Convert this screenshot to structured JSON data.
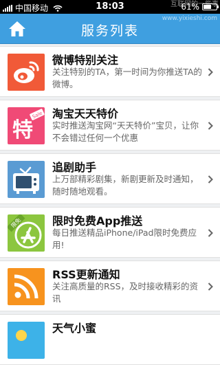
{
  "status_bar": {
    "carrier": "中国移动",
    "time": "18:03",
    "battery": "61%"
  },
  "watermark": {
    "text": "互联网的一些事",
    "url": "www.yixieshi.com"
  },
  "nav": {
    "title": "服务列表"
  },
  "colors": {
    "nav_blue": "#3f9fe0",
    "weibo": "#f15a38",
    "taobao": "#f04a76",
    "tv": "#5a9bd3",
    "app": "#8cc63f",
    "rss": "#f7931e",
    "weather": "#3db2e8"
  },
  "items": [
    {
      "title": "微博特别关注",
      "desc": "关注特别的TA，第一时间为你推送TA的微博。",
      "icon": "weibo-icon"
    },
    {
      "title": "淘宝天天特价",
      "desc": "实时推送淘宝网“天天特价”宝贝，让你不会错过任何一个优惠",
      "icon": "taobao-sale-icon",
      "icon_text": "特",
      "icon_tag": "Sale"
    },
    {
      "title": "追剧助手",
      "desc": "上万部精彩剧集，新剧更新及时通知，随时随地观看。",
      "icon": "tv-icon"
    },
    {
      "title": "限时免费App推送",
      "desc": "每日推送精品iPhone/iPad限时免费应用!",
      "icon": "app-store-icon",
      "icon_badge": "限免"
    },
    {
      "title": "RSS更新通知",
      "desc": "关注高质量的RSS，及时接收精彩的资讯",
      "icon": "rss-icon"
    },
    {
      "title": "天气小蜜",
      "desc": "",
      "icon": "weather-icon"
    }
  ]
}
